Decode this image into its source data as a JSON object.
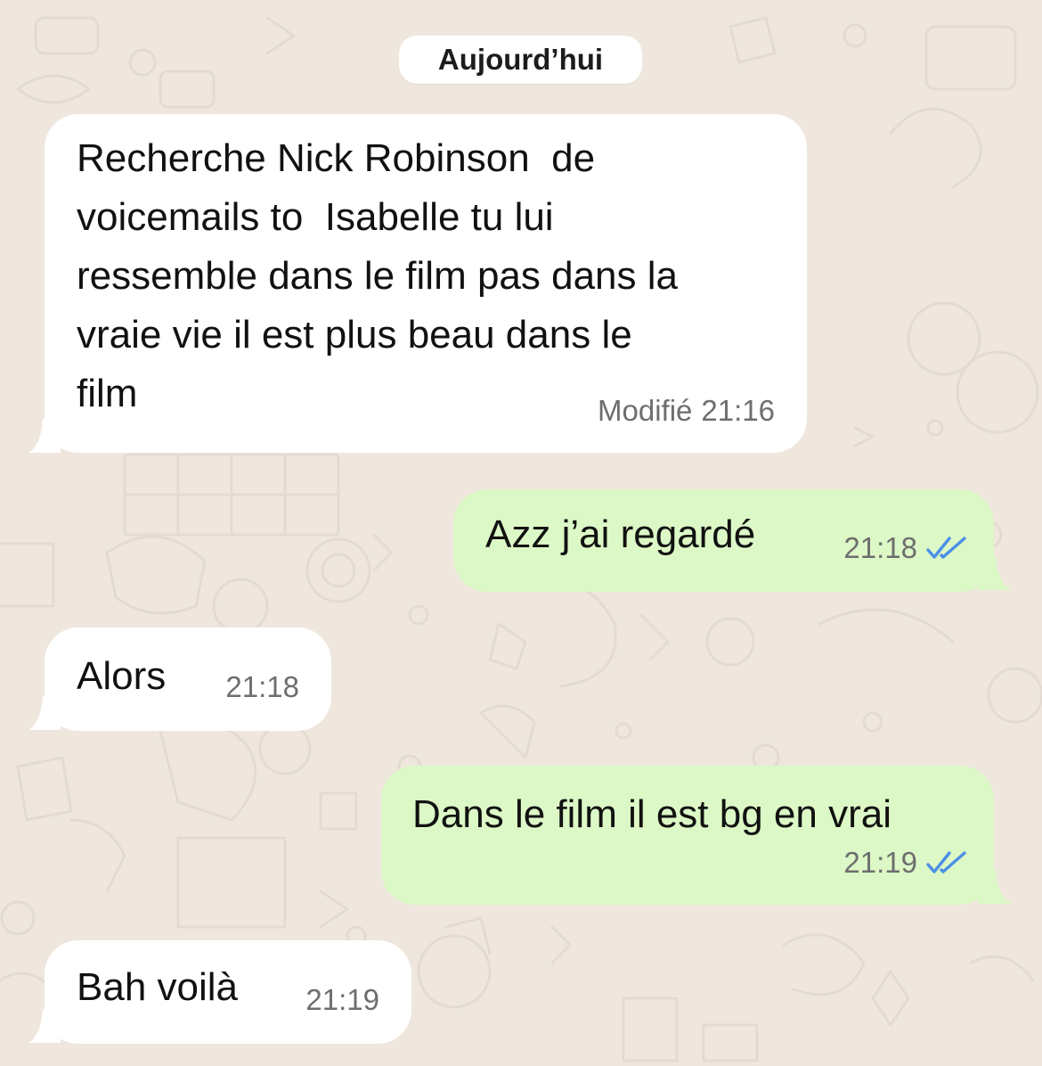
{
  "date_separator": "Aujourd’hui",
  "colors": {
    "background": "#EFE7DE",
    "incoming_bubble": "#FFFFFF",
    "outgoing_bubble": "#DCF8C6",
    "read_receipt": "#4A8FE7",
    "meta_text": "#6E6E6E"
  },
  "messages": [
    {
      "direction": "incoming",
      "text": "Recherche Nick Robinson  de\nvoicemails to  Isabelle tu lui\nressemble dans le film pas dans la\nvraie vie il est plus beau dans le\nfilm",
      "edited_label": "Modifié",
      "time": "21:16"
    },
    {
      "direction": "outgoing",
      "text": "Azz j’ai regardé",
      "time": "21:18",
      "status_icon": "double-check-read-icon"
    },
    {
      "direction": "incoming",
      "text": "Alors",
      "time": "21:18"
    },
    {
      "direction": "outgoing",
      "text": "Dans le film il est bg en vrai",
      "time": "21:19",
      "status_icon": "double-check-read-icon"
    },
    {
      "direction": "incoming",
      "text": "Bah voilà",
      "time": "21:19"
    }
  ]
}
